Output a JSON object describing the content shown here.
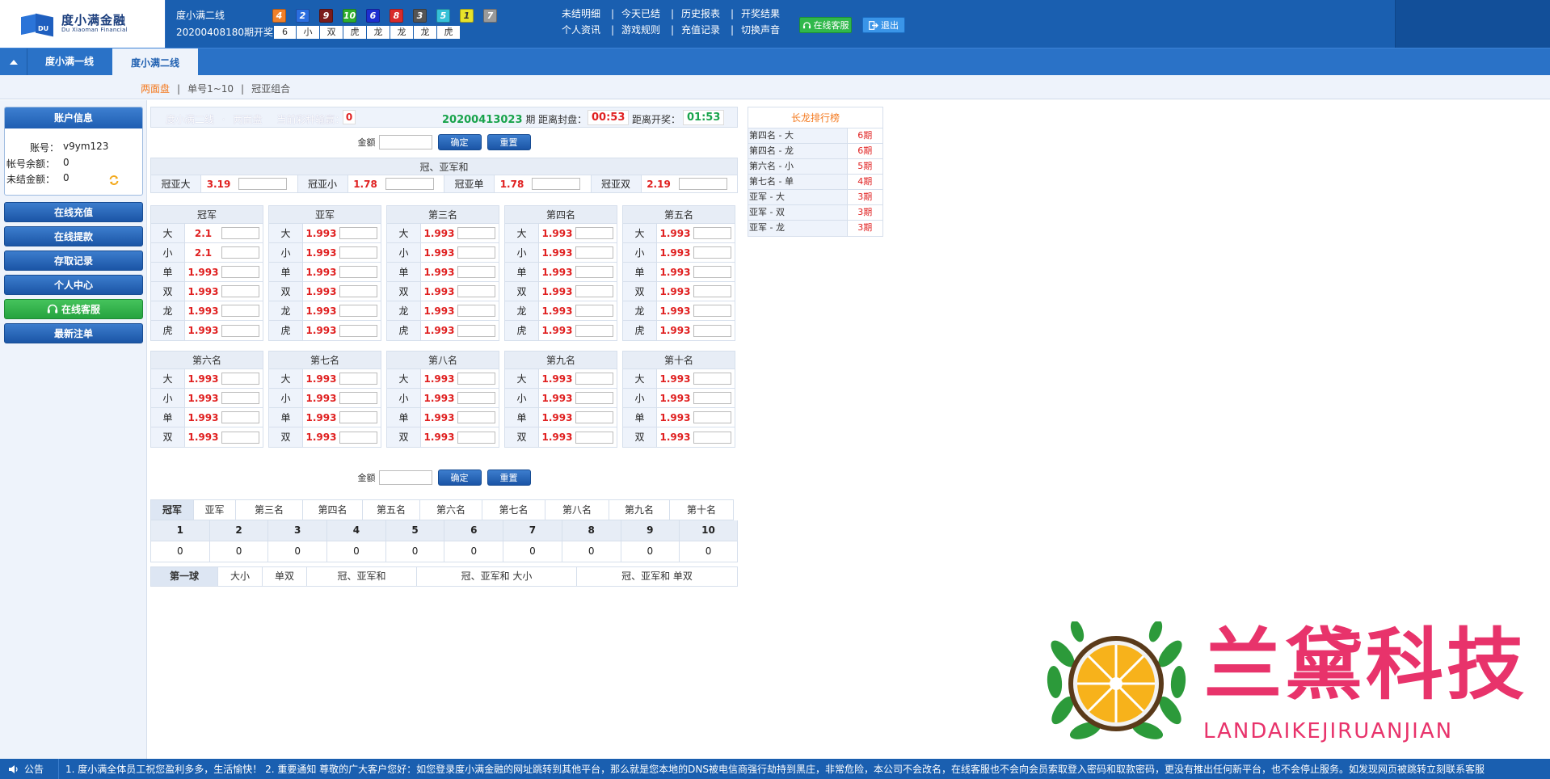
{
  "brand": {
    "name_cn": "度小满金融",
    "name_en": "Du Xiaoman Financial",
    "mark": "DU"
  },
  "header": {
    "lottery_name": "度小满二线",
    "period_text": "20200408180期开奖",
    "balls": [
      {
        "n": "4",
        "color": "#f0802a"
      },
      {
        "n": "2",
        "color": "#2a6ee0"
      },
      {
        "n": "9",
        "color": "#7a1b1b"
      },
      {
        "n": "10",
        "color": "#2eaf2e"
      },
      {
        "n": "6",
        "color": "#1d2fd0"
      },
      {
        "n": "8",
        "color": "#d82b2b"
      },
      {
        "n": "3",
        "color": "#555555"
      },
      {
        "n": "5",
        "color": "#35c1d8"
      },
      {
        "n": "1",
        "color": "#e7e22a"
      },
      {
        "n": "7",
        "color": "#9a9a9a"
      }
    ],
    "results": [
      "6",
      "小",
      "双",
      "虎",
      "龙",
      "龙",
      "龙",
      "虎"
    ],
    "links_row1": [
      "未结明细",
      "今天已结",
      "历史报表",
      "开奖结果"
    ],
    "links_row2": [
      "个人资讯",
      "游戏规则",
      "充值记录",
      "切换声音"
    ],
    "service_btn": "在线客服",
    "exit_btn": "退出"
  },
  "nav": {
    "tabs": [
      "度小满一线",
      "度小满二线"
    ],
    "active": 1
  },
  "subnav": {
    "items": [
      "两面盘",
      "单号1~10",
      "冠亚组合"
    ],
    "active": 0
  },
  "account": {
    "title": "账户信息",
    "username_label": "账号：",
    "username": "v9ym123",
    "balance_label": "帐号余额：",
    "balance": "0",
    "unsettled_label": "未结金额：",
    "unsettled": "0"
  },
  "sidebar_buttons": [
    "在线充值",
    "在线提款",
    "存取记录",
    "个人中心",
    "在线客服",
    "最新注单"
  ],
  "info_bar": {
    "game": "度小满二线",
    "dot": "·",
    "play": "两面盘",
    "pnl_label": "当前彩种输赢：",
    "pnl": "0",
    "period": "20200413023",
    "period_suffix": "期 距离封盘：",
    "close_timer": "00:53",
    "open_label": "距离开奖：",
    "open_timer": "01:53"
  },
  "amount": {
    "label": "金额",
    "confirm": "确定",
    "reset": "重置"
  },
  "gyh": {
    "title": "冠、亚军和",
    "items": [
      {
        "name": "冠亚大",
        "odds": "3.19"
      },
      {
        "name": "冠亚小",
        "odds": "1.78"
      },
      {
        "name": "冠亚单",
        "odds": "1.78"
      },
      {
        "name": "冠亚双",
        "odds": "2.19"
      }
    ]
  },
  "positions_top": [
    {
      "title": "冠军",
      "rows": [
        [
          "大",
          "2.1"
        ],
        [
          "小",
          "2.1"
        ],
        [
          "单",
          "1.993"
        ],
        [
          "双",
          "1.993"
        ],
        [
          "龙",
          "1.993"
        ],
        [
          "虎",
          "1.993"
        ]
      ]
    },
    {
      "title": "亚军",
      "rows": [
        [
          "大",
          "1.993"
        ],
        [
          "小",
          "1.993"
        ],
        [
          "单",
          "1.993"
        ],
        [
          "双",
          "1.993"
        ],
        [
          "龙",
          "1.993"
        ],
        [
          "虎",
          "1.993"
        ]
      ]
    },
    {
      "title": "第三名",
      "rows": [
        [
          "大",
          "1.993"
        ],
        [
          "小",
          "1.993"
        ],
        [
          "单",
          "1.993"
        ],
        [
          "双",
          "1.993"
        ],
        [
          "龙",
          "1.993"
        ],
        [
          "虎",
          "1.993"
        ]
      ]
    },
    {
      "title": "第四名",
      "rows": [
        [
          "大",
          "1.993"
        ],
        [
          "小",
          "1.993"
        ],
        [
          "单",
          "1.993"
        ],
        [
          "双",
          "1.993"
        ],
        [
          "龙",
          "1.993"
        ],
        [
          "虎",
          "1.993"
        ]
      ]
    },
    {
      "title": "第五名",
      "rows": [
        [
          "大",
          "1.993"
        ],
        [
          "小",
          "1.993"
        ],
        [
          "单",
          "1.993"
        ],
        [
          "双",
          "1.993"
        ],
        [
          "龙",
          "1.993"
        ],
        [
          "虎",
          "1.993"
        ]
      ]
    }
  ],
  "positions_bottom": [
    {
      "title": "第六名",
      "rows": [
        [
          "大",
          "1.993"
        ],
        [
          "小",
          "1.993"
        ],
        [
          "单",
          "1.993"
        ],
        [
          "双",
          "1.993"
        ]
      ]
    },
    {
      "title": "第七名",
      "rows": [
        [
          "大",
          "1.993"
        ],
        [
          "小",
          "1.993"
        ],
        [
          "单",
          "1.993"
        ],
        [
          "双",
          "1.993"
        ]
      ]
    },
    {
      "title": "第八名",
      "rows": [
        [
          "大",
          "1.993"
        ],
        [
          "小",
          "1.993"
        ],
        [
          "单",
          "1.993"
        ],
        [
          "双",
          "1.993"
        ]
      ]
    },
    {
      "title": "第九名",
      "rows": [
        [
          "大",
          "1.993"
        ],
        [
          "小",
          "1.993"
        ],
        [
          "单",
          "1.993"
        ],
        [
          "双",
          "1.993"
        ]
      ]
    },
    {
      "title": "第十名",
      "rows": [
        [
          "大",
          "1.993"
        ],
        [
          "小",
          "1.993"
        ],
        [
          "单",
          "1.993"
        ],
        [
          "双",
          "1.993"
        ]
      ]
    }
  ],
  "stats": {
    "tabs": [
      "冠军",
      "亚军",
      "第三名",
      "第四名",
      "第五名",
      "第六名",
      "第七名",
      "第八名",
      "第九名",
      "第十名"
    ],
    "numbers": [
      "1",
      "2",
      "3",
      "4",
      "5",
      "6",
      "7",
      "8",
      "9",
      "10"
    ],
    "counts": [
      "0",
      "0",
      "0",
      "0",
      "0",
      "0",
      "0",
      "0",
      "0",
      "0"
    ],
    "tabs2": [
      "第一球",
      "大小",
      "单双",
      "冠、亚军和",
      "冠、亚军和 大小",
      "冠、亚军和 单双"
    ]
  },
  "ranking": {
    "title": "长龙排行榜",
    "rows": [
      {
        "name": "第四名 - 大",
        "periods": "6期"
      },
      {
        "name": "第四名 - 龙",
        "periods": "6期"
      },
      {
        "name": "第六名 - 小",
        "periods": "5期"
      },
      {
        "name": "第七名 - 单",
        "periods": "4期"
      },
      {
        "name": "亚军 - 大",
        "periods": "3期"
      },
      {
        "name": "亚军 - 双",
        "periods": "3期"
      },
      {
        "name": "亚军 - 龙",
        "periods": "3期"
      }
    ]
  },
  "watermark": {
    "cn": "兰黛科技",
    "en": "LANDAIKEJIRUANJIAN"
  },
  "ticker": {
    "label": "公告",
    "message": "1. 度小满全体员工祝您盈利多多，生活愉快！ 2. 重要通知 尊敬的广大客户您好：如您登录度小满金融的网址跳转到其他平台，那么就是您本地的DNS被电信商强行劫持到黑庄，非常危险，本公司不会改名，在线客服也不会向会员索取登入密码和取款密码，更没有推出任何新平台，也不会停止服务。如发现网页被跳转立刻联系客服"
  }
}
